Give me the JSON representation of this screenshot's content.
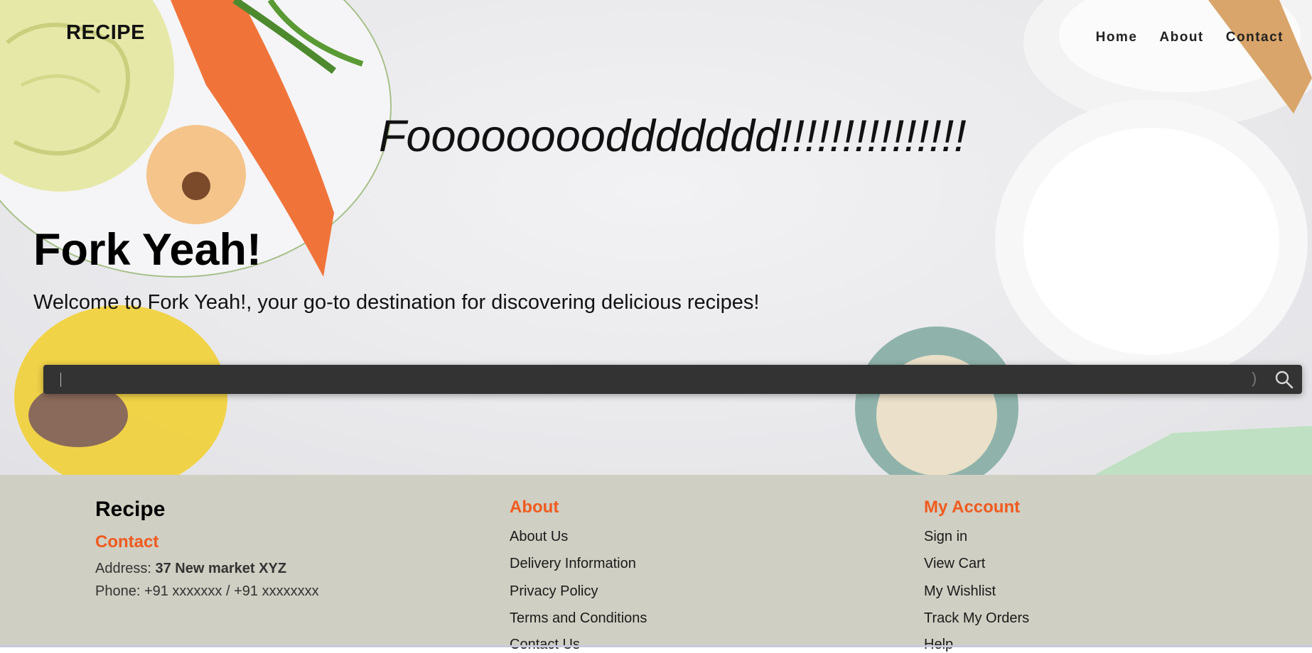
{
  "header": {
    "brand": "RECIPE",
    "nav": [
      "Home",
      "About",
      "Contact"
    ]
  },
  "hero": {
    "tagline": "Fooooooooddddddd!!!!!!!!!!!!!!!",
    "heading": "Fork Yeah!",
    "welcome": "Welcome to Fork Yeah!, your go-to destination for discovering delicious recipes!"
  },
  "search": {
    "value": "",
    "placeholder": "",
    "paren": ")",
    "icon": "search-icon"
  },
  "footer": {
    "brand": "Recipe",
    "contact_heading": "Contact",
    "address_label": "Address:",
    "address_value": "37 New market XYZ",
    "phone": "Phone: +91 xxxxxxx / +91 xxxxxxxx",
    "about_heading": "About",
    "about_links": [
      "About Us",
      "Delivery Information",
      "Privacy Policy",
      "Terms and Conditions",
      "Contact Us"
    ],
    "account_heading": "My Account",
    "account_links": [
      "Sign in",
      "View Cart",
      "My Wishlist",
      "Track My Orders",
      "Help"
    ]
  },
  "colors": {
    "accent": "#f05a1e",
    "footer_bg": "#cfcfc3",
    "search_bg": "#333333"
  }
}
